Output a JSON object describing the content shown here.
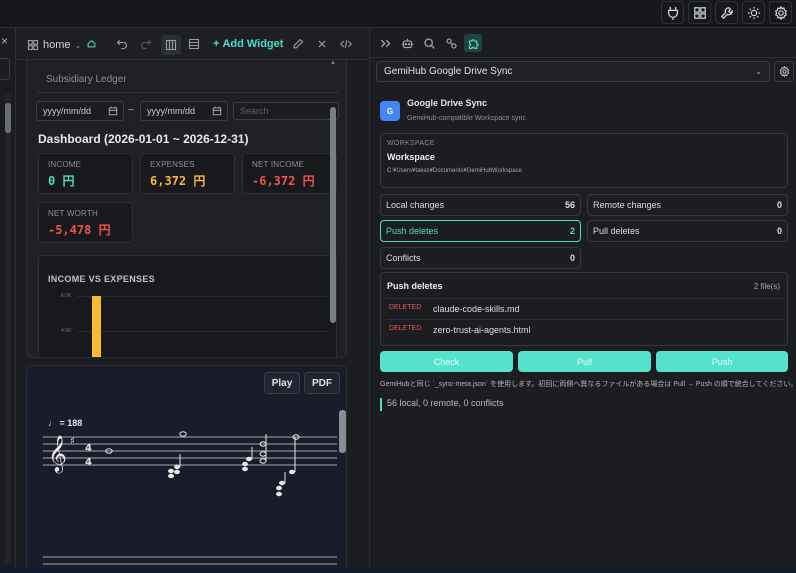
{
  "top_icons": [
    "plug-icon",
    "grid-icon",
    "wrench-icon",
    "sun-icon",
    "gear-icon"
  ],
  "left_strip": {
    "close_glyph": "×"
  },
  "toolbar": {
    "home_label": "home",
    "add_widget_label": "Add Widget"
  },
  "ledger": {
    "tab_fragments": [
      "",
      "",
      ""
    ],
    "subsidiary_label": "Subsidiary Ledger",
    "date_from_placeholder": "yyyy/mm/dd",
    "date_to_placeholder": "yyyy/mm/dd",
    "date_separator": "~",
    "search_placeholder": "Search",
    "dashboard_title": "Dashboard (2026-01-01 ~ 2026-12-31)",
    "cards": [
      {
        "label": "INCOME",
        "value": "0 円",
        "color": "#4fdcc4"
      },
      {
        "label": "EXPENSES",
        "value": "6,372 円",
        "color": "#f5b93a"
      },
      {
        "label": "NET INCOME",
        "value": "-6,372 円",
        "color": "#ef5350"
      },
      {
        "label": "NET WORTH",
        "value": "-5,478 円",
        "color": "#ef5350"
      }
    ]
  },
  "chart_data": {
    "type": "bar",
    "title": "INCOME VS EXPENSES",
    "y_ticks": [
      "6.0K",
      "4.0K"
    ],
    "ylim": [
      0,
      6500
    ],
    "series": [
      {
        "values": [
          6000
        ],
        "color": "#f7bd2a"
      }
    ]
  },
  "music": {
    "play_label": "Play",
    "pdf_label": "PDF",
    "tempo": "♩ = 188"
  },
  "sync": {
    "plugin_selected": "GemiHub Google Drive Sync",
    "badge_letter": "G",
    "title": "Google Drive Sync",
    "subtitle": "GemiHub-compatible Workspace sync",
    "workspace_label": "WORKSPACE",
    "workspace_name": "Workspace",
    "workspace_path": "C:¥Users¥takes¥Documents¥GemiHubWorkspace",
    "stats": [
      {
        "label": "Local changes",
        "value": "56"
      },
      {
        "label": "Remote changes",
        "value": "0"
      },
      {
        "label": "Push deletes",
        "value": "2"
      },
      {
        "label": "Pull deletes",
        "value": "0"
      },
      {
        "label": "Conflicts",
        "value": "0"
      }
    ],
    "push_deletes_title": "Push deletes",
    "push_deletes_count": "2 file(s)",
    "deleted_files": [
      {
        "tag": "DELETED",
        "name": "claude-code-skills.md"
      },
      {
        "tag": "DELETED",
        "name": "zero-trust-ai-agents.html"
      }
    ],
    "buttons": {
      "check": "Check",
      "pull": "Pull",
      "push": "Push"
    },
    "notice": "GemiHubと同じ `_sync-meta.json` を使用します。初回に両側へ異なるファイルがある場合は Pull → Push の順で統合してください。",
    "summary": "56 local, 0 remote, 0 conflicts"
  }
}
